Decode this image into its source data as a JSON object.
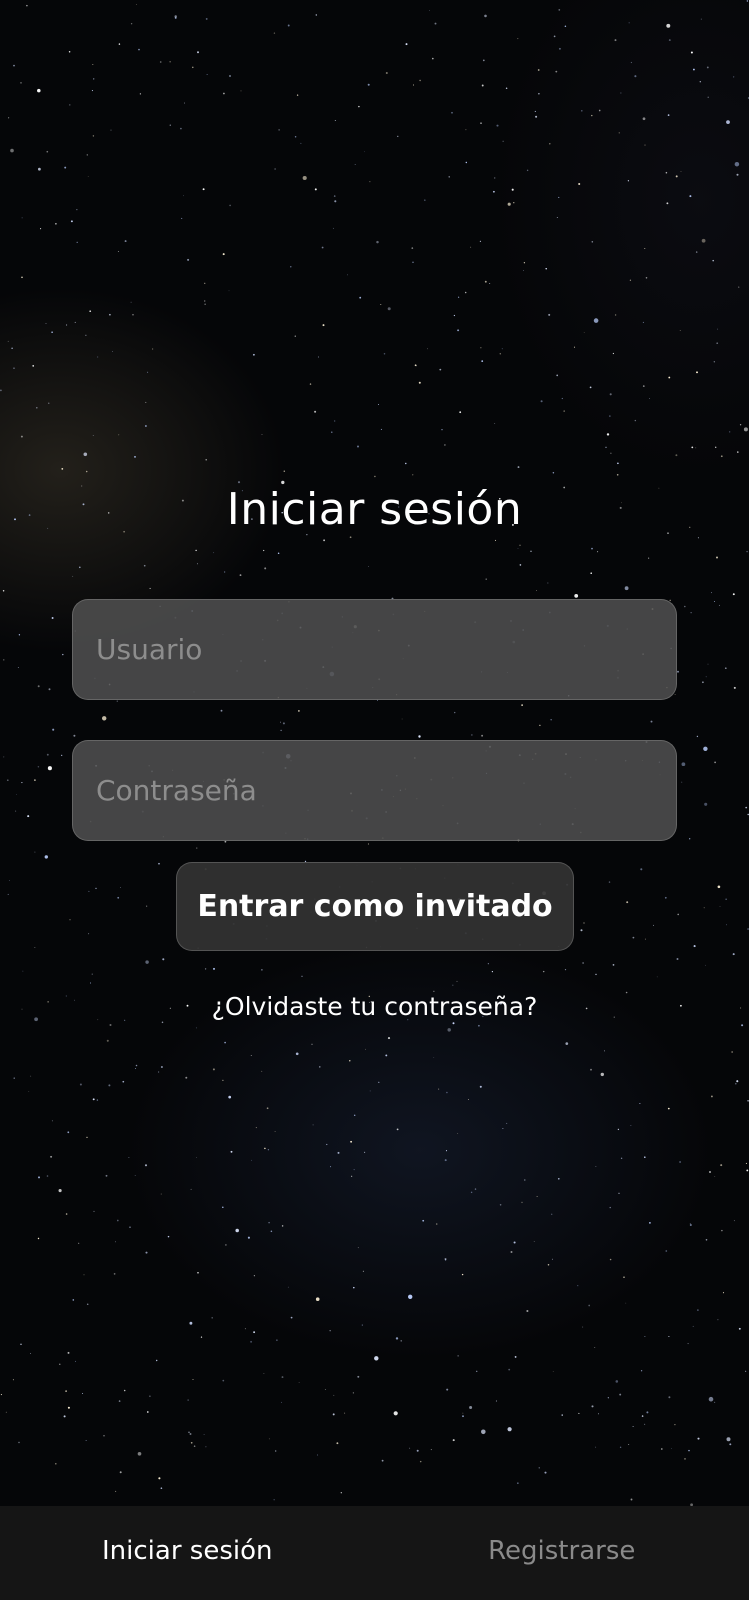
{
  "login": {
    "title": "Iniciar sesión",
    "username_placeholder": "Usuario",
    "password_placeholder": "Contraseña",
    "guest_button_label": "Entrar como invitado",
    "forgot_password_link": "¿Olvidaste tu contraseña?"
  },
  "bottom_nav": {
    "items": [
      {
        "label": "Iniciar sesión",
        "active": true
      },
      {
        "label": "Registrarse",
        "active": false
      }
    ]
  },
  "colors": {
    "background": "#050608",
    "field_background": "#4e4e4e",
    "button_background": "#323232",
    "nav_background": "#151515",
    "text_primary": "#ffffff",
    "text_muted": "#8a8a8a"
  }
}
